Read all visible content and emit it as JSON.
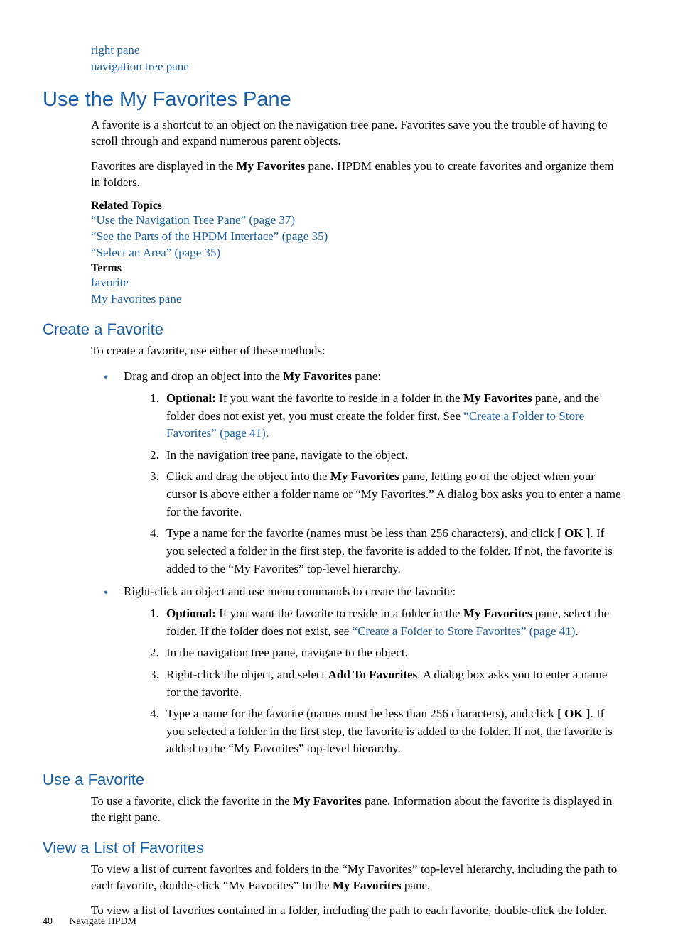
{
  "pre_terms": {
    "line1": "right pane",
    "line2": "navigation tree pane"
  },
  "h1_myfav": "Use the My Favorites Pane",
  "p_fav_intro_a": "A favorite is a shortcut to an object on the navigation tree pane. Favorites save you the trouble of having to scroll through and expand numerous parent objects.",
  "p_fav_intro_b_pre": "Favorites are displayed in the ",
  "p_fav_intro_b_bold": "My Favorites",
  "p_fav_intro_b_post": " pane. HPDM enables you to create favorites and organize them in folders.",
  "related_topics_label": "Related Topics",
  "rel1": "“Use the Navigation Tree Pane” (page 37)",
  "rel2": "“See the Parts of the HPDM Interface” (page 35)",
  "rel3": "“Select an Area” (page 35)",
  "terms_label": "Terms",
  "term1": "favorite",
  "term2": "My Favorites pane",
  "h2_create": "Create a Favorite",
  "p_create_intro": "To create a favorite, use either of these methods:",
  "bullet1_pre": "Drag and drop an object into the ",
  "bullet1_bold": "My Favorites",
  "bullet1_post": " pane:",
  "b1_s1_opt": "Optional:",
  "b1_s1_a": " If you want the favorite to reside in a folder in the ",
  "b1_s1_bold": "My Favorites",
  "b1_s1_b": " pane, and the folder does not exist yet, you must create the folder first. See ",
  "b1_s1_link": "“Create a Folder to Store Favorites” (page 41)",
  "b1_s1_c": ".",
  "b1_s2": "In the navigation tree pane, navigate to the object.",
  "b1_s3_a": "Click and drag the object into the ",
  "b1_s3_bold": "My Favorites",
  "b1_s3_b": " pane, letting go of the object when your cursor is above either a folder name or “My Favorites.” A dialog box asks you to enter a name for the favorite.",
  "b1_s4_a": "Type a name for the favorite (names must be less than 256 characters), and click ",
  "b1_s4_bold": "[ OK ]",
  "b1_s4_b": ". If you selected a folder in the first step, the favorite is added to the folder. If not, the favorite is added to the “My Favorites” top-level hierarchy.",
  "bullet2": "Right-click an object and use menu commands to create the favorite:",
  "b2_s1_opt": "Optional:",
  "b2_s1_a": " If you want the favorite to reside in a folder in the ",
  "b2_s1_bold": "My Favorites",
  "b2_s1_b": " pane, select the folder. If the folder does not exist, see ",
  "b2_s1_link": "“Create a Folder to Store Favorites” (page 41)",
  "b2_s1_c": ".",
  "b2_s2": "In the navigation tree pane, navigate to the object.",
  "b2_s3_a": "Right-click the object, and select ",
  "b2_s3_bold": "Add To Favorites",
  "b2_s3_b": ". A dialog box asks you to enter a name for the favorite.",
  "b2_s4_a": "Type a name for the favorite (names must be less than 256 characters), and click ",
  "b2_s4_bold": "[ OK ]",
  "b2_s4_b": ". If you selected a folder in the first step, the favorite is added to the folder. If not, the favorite is added to the “My Favorites” top-level hierarchy.",
  "h2_use": "Use a Favorite",
  "p_use_a": "To use a favorite, click the favorite in the ",
  "p_use_bold": "My Favorites",
  "p_use_b": " pane. Information about the favorite is displayed in the right pane.",
  "h2_view": "View a List of Favorites",
  "p_view_a_pre": "To view a list of current favorites and folders in the “My Favorites” top-level hierarchy, including the path to each favorite, double-click “My Favorites” In the ",
  "p_view_a_bold": "My Favorites",
  "p_view_a_post": " pane.",
  "p_view_b": "To view a list of favorites contained in a folder, including the path to each favorite, double-click the folder.",
  "footer_page": "40",
  "footer_title": "Navigate HPDM"
}
